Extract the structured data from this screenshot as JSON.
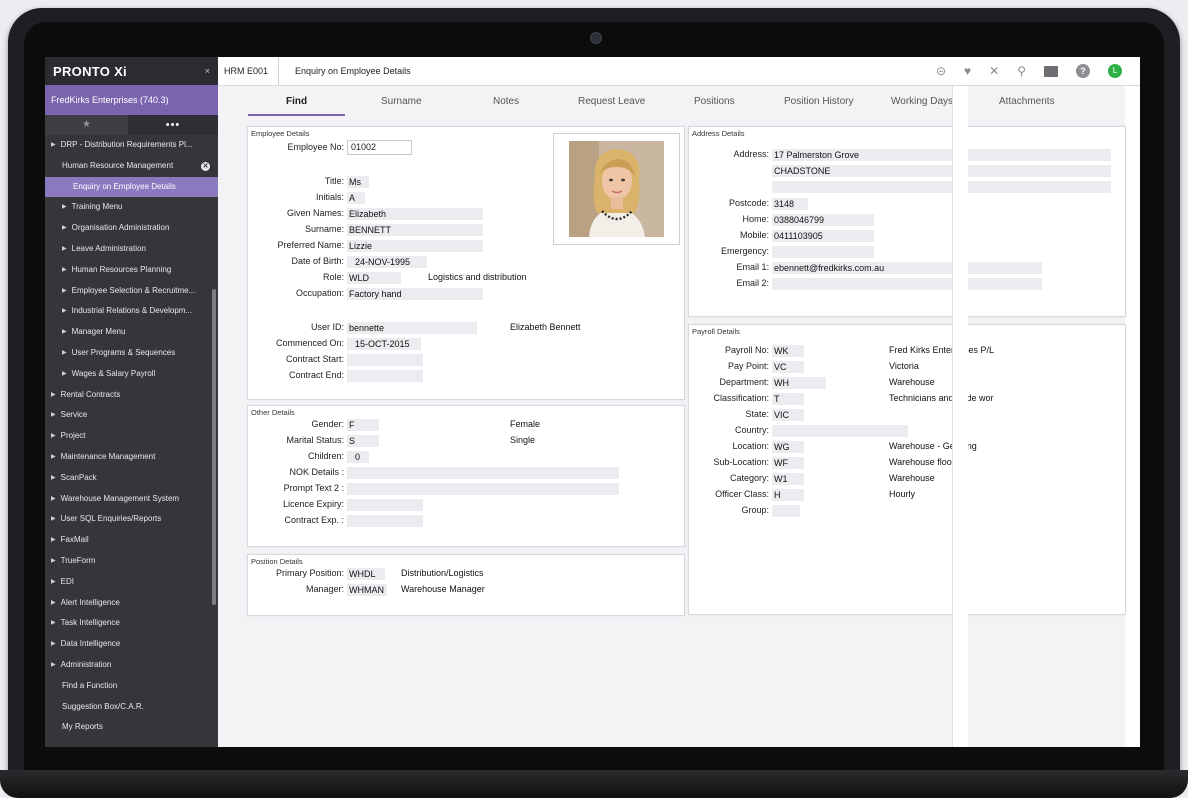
{
  "app": {
    "logo": "PRONTO Xi",
    "close_symbol": "×",
    "company": "FredKirks Enterprises (740.3)",
    "fav_star": "★",
    "fav_more": "•••"
  },
  "sidebar": {
    "items": [
      {
        "label": "DRP - Distribution Requirements Pl...",
        "level": 1
      },
      {
        "label": "Human Resource Management",
        "level": 2
      },
      {
        "label": "Enquiry on Employee Details",
        "level": 3
      },
      {
        "label": "Training Menu",
        "level": 2
      },
      {
        "label": "Organisation Administration",
        "level": 2
      },
      {
        "label": "Leave Administration",
        "level": 2
      },
      {
        "label": "Human Resources Planning",
        "level": 2
      },
      {
        "label": "Employee Selection & Recruitme...",
        "level": 2
      },
      {
        "label": "Industrial Relations & Developm...",
        "level": 2
      },
      {
        "label": "Manager Menu",
        "level": 2
      },
      {
        "label": "User Programs & Sequences",
        "level": 2
      },
      {
        "label": "Wages & Salary Payroll",
        "level": 2
      },
      {
        "label": "Rental Contracts",
        "level": 1
      },
      {
        "label": "Service",
        "level": 1
      },
      {
        "label": "Project",
        "level": 1
      },
      {
        "label": "Maintenance Management",
        "level": 1
      },
      {
        "label": "ScanPack",
        "level": 1
      },
      {
        "label": "Warehouse Management System",
        "level": 1
      },
      {
        "label": "User SQL Enquiries/Reports",
        "level": 1
      },
      {
        "label": "FaxMail",
        "level": 1
      },
      {
        "label": "TrueForm",
        "level": 1
      },
      {
        "label": "EDI",
        "level": 1
      },
      {
        "label": "Alert Intelligence",
        "level": 1
      },
      {
        "label": "Task Intelligence",
        "level": 1
      },
      {
        "label": "Data Intelligence",
        "level": 1
      },
      {
        "label": "Administration",
        "level": 1
      },
      {
        "label": "Find a Function",
        "level": 1
      },
      {
        "label": "Suggestion Box/C.A.R.",
        "level": 1
      },
      {
        "label": "My Reports",
        "level": 1
      }
    ]
  },
  "topbar": {
    "code": "HRM E001",
    "title": "Enquiry on Employee Details",
    "user_initial": "L",
    "help_symbol": "?",
    "search_symbol": "⚲",
    "close_symbol": "✕",
    "heart_symbol": "♥",
    "link_symbol": "⊝"
  },
  "tabs": [
    "Find",
    "Surname",
    "Notes",
    "Request Leave",
    "Positions",
    "Position History",
    "Working Days",
    "Attachments"
  ],
  "employee": {
    "title": "Employee Details",
    "fields": {
      "employee_no": {
        "label": "Employee No:",
        "value": "01002"
      },
      "title": {
        "label": "Title:",
        "value": "Ms"
      },
      "initials": {
        "label": "Initials:",
        "value": "A"
      },
      "given_names": {
        "label": "Given Names:",
        "value": "Elizabeth"
      },
      "surname": {
        "label": "Surname:",
        "value": "BENNETT"
      },
      "preferred_name": {
        "label": "Preferred Name:",
        "value": "Lizzie"
      },
      "dob": {
        "label": "Date of Birth:",
        "value": "24-NOV-1995"
      },
      "role": {
        "label": "Role:",
        "value": "WLD",
        "desc": "Logistics and distribution"
      },
      "occupation": {
        "label": "Occupation:",
        "value": "Factory hand"
      },
      "user_id": {
        "label": "User ID:",
        "value": "bennette",
        "desc": "Elizabeth Bennett"
      },
      "commenced": {
        "label": "Commenced On:",
        "value": "15-OCT-2015"
      },
      "contract_start": {
        "label": "Contract Start:",
        "value": ""
      },
      "contract_end": {
        "label": "Contract End:",
        "value": ""
      }
    }
  },
  "other": {
    "title": "Other Details",
    "fields": {
      "gender": {
        "label": "Gender:",
        "value": "F",
        "desc": "Female"
      },
      "marital": {
        "label": "Marital Status:",
        "value": "S",
        "desc": "Single"
      },
      "children": {
        "label": "Children:",
        "value": "0"
      },
      "nok": {
        "label": "NOK Details :",
        "value": ""
      },
      "prompt2": {
        "label": "Prompt Text 2 :",
        "value": ""
      },
      "licence": {
        "label": "Licence Expiry:",
        "value": ""
      },
      "contract_exp": {
        "label": "Contract Exp. :",
        "value": ""
      }
    }
  },
  "position": {
    "title": "Position Details",
    "fields": {
      "primary": {
        "label": "Primary Position:",
        "value": "WHDL",
        "desc": "Distribution/Logistics"
      },
      "manager": {
        "label": "Manager:",
        "value": "WHMAN",
        "desc": "Warehouse Manager"
      }
    }
  },
  "address": {
    "title": "Address Details",
    "fields": {
      "address1": {
        "label": "Address:",
        "value": "17 Palmerston Grove"
      },
      "address2": {
        "value": "CHADSTONE"
      },
      "address3": {
        "value": ""
      },
      "postcode": {
        "label": "Postcode:",
        "value": "3148"
      },
      "home": {
        "label": "Home:",
        "value": "0388046799"
      },
      "mobile": {
        "label": "Mobile:",
        "value": "0411103905"
      },
      "emergency": {
        "label": "Emergency:",
        "value": ""
      },
      "email1": {
        "label": "Email 1:",
        "value": "ebennett@fredkirks.com.au"
      },
      "email2": {
        "label": "Email 2:",
        "value": ""
      }
    }
  },
  "payroll": {
    "title": "Payroll Details",
    "fields": {
      "payroll_no": {
        "label": "Payroll No:",
        "value": "WK",
        "desc": "Fred Kirks Enterprises P/L"
      },
      "pay_point": {
        "label": "Pay Point:",
        "value": "VC",
        "desc": "Victoria"
      },
      "department": {
        "label": "Department:",
        "value": "WH",
        "desc": "Warehouse"
      },
      "classification": {
        "label": "Classification:",
        "value": "T",
        "desc": "Technicians and trade wor"
      },
      "state": {
        "label": "State:",
        "value": "VIC"
      },
      "country": {
        "label": "Country:",
        "value": ""
      },
      "location": {
        "label": "Location:",
        "value": "WG",
        "desc": "Warehouse - Geelong"
      },
      "sub_location": {
        "label": "Sub-Location:",
        "value": "WF",
        "desc": "Warehouse floor"
      },
      "category": {
        "label": "Category:",
        "value": "W1",
        "desc": "Warehouse"
      },
      "officer_class": {
        "label": "Officer Class:",
        "value": "H",
        "desc": "Hourly"
      },
      "group": {
        "label": "Group:",
        "value": ""
      }
    }
  }
}
